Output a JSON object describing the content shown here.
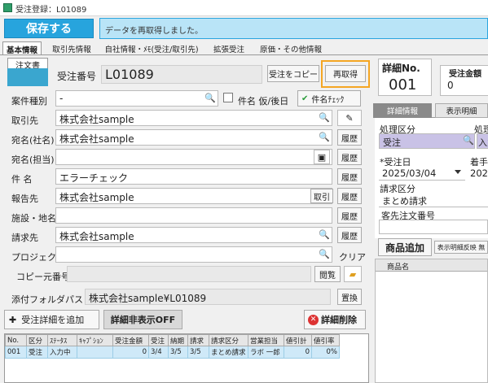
{
  "window": {
    "title": "受注登録：L01089"
  },
  "toolbar": {
    "save_label": "保存する",
    "message": "データを再取得しました。"
  },
  "tabs": [
    "基本情報",
    "取引先情報",
    "自社情報・ﾒﾓ(受注/取引先)",
    "拡張受注",
    "原価・その他情報"
  ],
  "order": {
    "badge": "注文書",
    "number_label": "受注番号",
    "number": "L01089",
    "copy_btn": "受注をコピー",
    "refetch_btn": "再取得"
  },
  "fields": {
    "type_label": "案件種別",
    "type_value": "-",
    "tentative_label": "件名 仮/後日",
    "name_check_label": "件名ﾁｪｯｸ",
    "client_label": "取引先",
    "client_value": "株式会社sample",
    "addr_company_label": "宛名(社名)",
    "addr_company_value": "株式会社sample",
    "addr_person_label": "宛名(担当)",
    "addr_person_value": "",
    "subject_label": "件 名",
    "subject_value": "エラーチェック",
    "report_label": "報告先",
    "report_value": "株式会社sample",
    "facility_label": "施設・地名",
    "facility_value": "",
    "billing_label": "請求先",
    "billing_value": "株式会社sample",
    "project_label": "プロジェクト",
    "project_value": "",
    "clear_label": "クリア",
    "copy_src_label": "コピー元番号",
    "copy_src_value": "",
    "browse_btn": "閲覧",
    "folder_label": "添付フォルダパス",
    "folder_value": "株式会社sample¥L01089",
    "replace_btn": "置換",
    "history": "履歴",
    "pull": "取引"
  },
  "actions": {
    "add_detail": "受注詳細を追加",
    "hide_detail": "詳細非表示OFF",
    "delete_detail": "詳細削除"
  },
  "grid": {
    "headers": [
      "No.",
      "区分",
      "ｽﾃｰﾀｽ",
      "ｷｬﾌﾟｼｮﾝ",
      "受注金額",
      "受注",
      "納期",
      "請求",
      "請求区分",
      "営業担当",
      "値引計",
      "値引率"
    ],
    "rows": [
      [
        "001",
        "受注",
        "入力中",
        "",
        "0",
        "3/4",
        "3/5",
        "3/5",
        "まとめ請求",
        "ラボ 一郎",
        "0",
        "0%"
      ]
    ]
  },
  "right": {
    "detail_no_label": "詳細No.",
    "detail_no": "001",
    "amount_label": "受注金額",
    "amount": "0",
    "tab_detail": "詳細情報",
    "tab_display": "表示明細",
    "proc_label": "処理区分",
    "proc_value": "受注",
    "proc_label2": "処理",
    "proc_value2": "入力",
    "date_label": "*受注日",
    "date_value": "2025/03/04",
    "start_label": "着手",
    "start_value": "202",
    "billing_kind_label": "請求区分",
    "billing_kind_value": "まとめ請求",
    "cust_no_label": "客先注文番号",
    "add_product": "商品追加",
    "reflect_btn": "表示明細反映 無",
    "product_col": "商品名"
  }
}
